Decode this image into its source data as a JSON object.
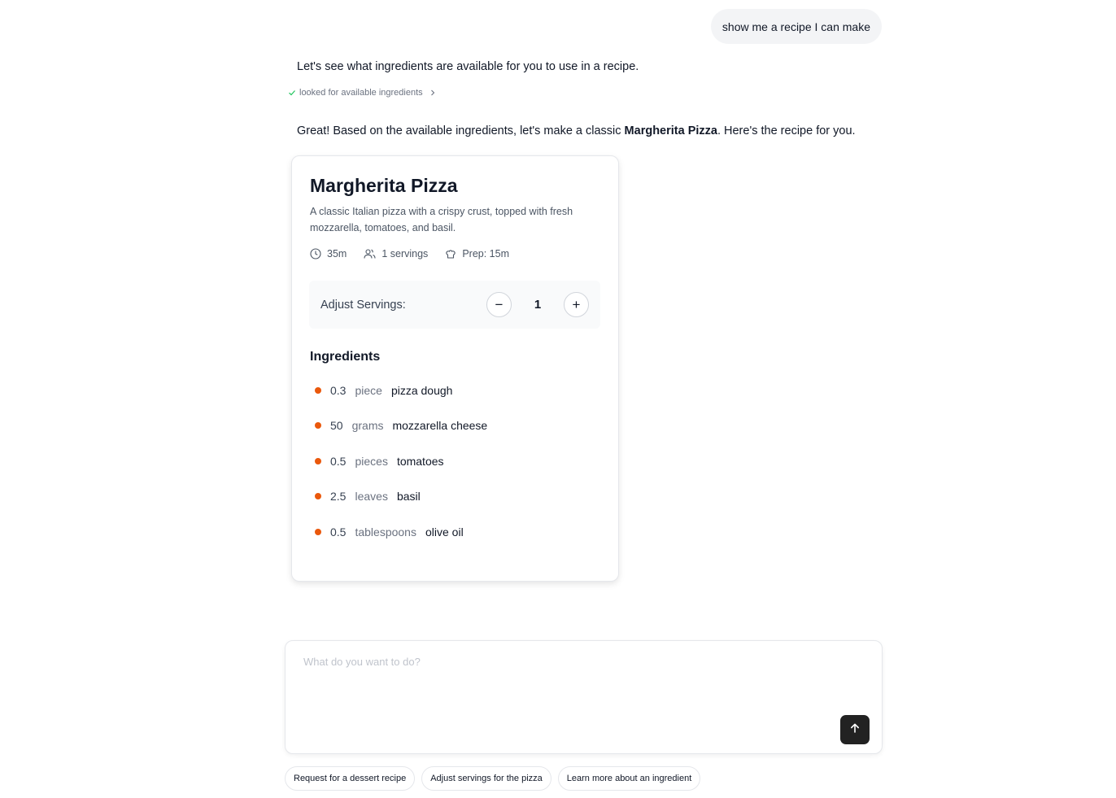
{
  "user_message": "show me a recipe I can make",
  "assistant": {
    "message_1": "Let's see what ingredients are available for you to use in a recipe.",
    "tool_status": "looked for available ingredients",
    "message_2_prefix": "Great! Based on the available ingredients, let's make a classic ",
    "message_2_bold": "Margherita Pizza",
    "message_2_suffix": ". Here's the recipe for you."
  },
  "recipe": {
    "title": "Margherita Pizza",
    "description": "A classic Italian pizza with a crispy crust, topped with fresh mozzarella, tomatoes, and basil.",
    "meta": {
      "time": "35m",
      "servings": "1 servings",
      "prep": "Prep: 15m"
    },
    "adjust_label": "Adjust Servings:",
    "servings_count": "1",
    "minus_label": "−",
    "plus_label": "+",
    "ingredients_title": "Ingredients",
    "ingredients": [
      {
        "qty": "0.3",
        "unit": "piece",
        "name": "pizza dough"
      },
      {
        "qty": "50",
        "unit": "grams",
        "name": "mozzarella cheese"
      },
      {
        "qty": "0.5",
        "unit": "pieces",
        "name": "tomatoes"
      },
      {
        "qty": "2.5",
        "unit": "leaves",
        "name": "basil"
      },
      {
        "qty": "0.5",
        "unit": "tablespoons",
        "name": "olive oil"
      }
    ]
  },
  "composer": {
    "placeholder": "What do you want to do?",
    "value": ""
  },
  "suggestions": [
    "Request for a dessert recipe",
    "Adjust servings for the pizza",
    "Learn more about an ingredient"
  ],
  "icons": {
    "tool_check": "check-icon",
    "tool_chevron": "chevron-right-icon",
    "time": "clock-icon",
    "servings": "users-icon",
    "prep": "chef-hat-icon",
    "send": "arrow-up-icon"
  },
  "colors": {
    "accent_dot": "#ea580c",
    "send_button": "#222222",
    "check": "#22c55e"
  }
}
